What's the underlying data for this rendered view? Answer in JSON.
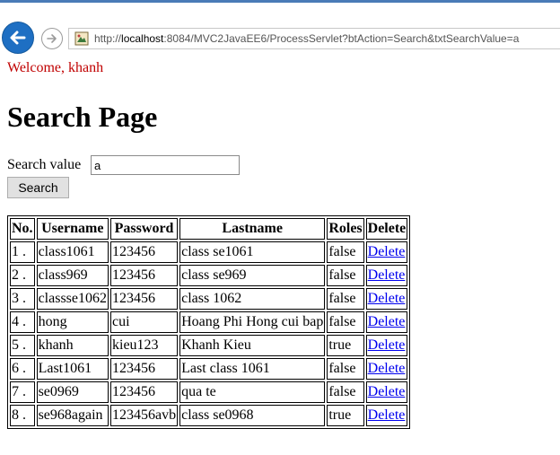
{
  "browser": {
    "url_prefix": "http://",
    "url_host": "localhost",
    "url_rest": ":8084/MVC2JavaEE6/ProcessServlet?btAction=Search&txtSearchValue=a"
  },
  "welcome": "Welcome, khanh",
  "title": "Search Page",
  "search": {
    "label": "Search value",
    "value": "a",
    "button_label": "Search"
  },
  "table": {
    "headers": [
      "No.",
      "Username",
      "Password",
      "Lastname",
      "Roles",
      "Delete"
    ],
    "rows": [
      {
        "no": "1 .",
        "username": "class1061",
        "password": "123456",
        "lastname": "class se1061",
        "roles": "false",
        "delete": "Delete"
      },
      {
        "no": "2 .",
        "username": "class969",
        "password": "123456",
        "lastname": "class se969",
        "roles": "false",
        "delete": "Delete"
      },
      {
        "no": "3 .",
        "username": "classse1062",
        "password": "123456",
        "lastname": "class 1062",
        "roles": "false",
        "delete": "Delete"
      },
      {
        "no": "4 .",
        "username": "hong",
        "password": "cui",
        "lastname": "Hoang Phi Hong cui bap",
        "roles": "false",
        "delete": "Delete"
      },
      {
        "no": "5 .",
        "username": "khanh",
        "password": "kieu123",
        "lastname": "Khanh Kieu",
        "roles": "true",
        "delete": "Delete"
      },
      {
        "no": "6 .",
        "username": "Last1061",
        "password": "123456",
        "lastname": "Last class 1061",
        "roles": "false",
        "delete": "Delete"
      },
      {
        "no": "7 .",
        "username": "se0969",
        "password": "123456",
        "lastname": "qua te",
        "roles": "false",
        "delete": "Delete"
      },
      {
        "no": "8 .",
        "username": "se968again",
        "password": "123456avb",
        "lastname": "class se0968",
        "roles": "true",
        "delete": "Delete"
      }
    ]
  },
  "icons": {
    "back": "back-arrow-icon",
    "forward": "forward-arrow-icon",
    "site": "page-icon"
  },
  "colors": {
    "welcome": "#c00000",
    "link": "#0000ee",
    "back_button": "#1e6fc3"
  }
}
